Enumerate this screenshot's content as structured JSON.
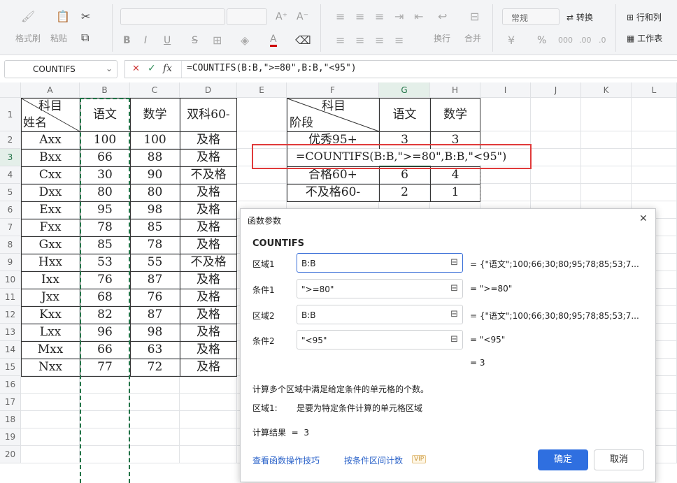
{
  "ribbon": {
    "format_painter": "格式刷",
    "paste": "粘贴",
    "wrap": "换行",
    "merge": "合并",
    "number_format": "常规",
    "convert": "转换",
    "row_col": "行和列",
    "worksheet": "工作表",
    "bold": "B",
    "italic": "I",
    "underline": "U",
    "strike": "S",
    "font_color": "A",
    "grow_font": "A⁺",
    "shrink_font": "A⁻",
    "percent": "%"
  },
  "formula_bar": {
    "name_box": "COUNTIFS",
    "cancel": "✕",
    "confirm": "✓",
    "fx": "fx",
    "formula": "=COUNTIFS(B:B,\">=80\",B:B,\"<95\")"
  },
  "sheet": {
    "columns": [
      "A",
      "B",
      "C",
      "D",
      "E",
      "F",
      "G",
      "H",
      "I",
      "J",
      "K",
      "L"
    ],
    "rows": [
      "1",
      "2",
      "3",
      "4",
      "5",
      "6",
      "7",
      "8",
      "9",
      "10",
      "11",
      "12",
      "13",
      "14",
      "15",
      "16",
      "17",
      "18",
      "19",
      "20"
    ],
    "a1_top": "科目",
    "a1_bottom": "姓名",
    "header_b": "语文",
    "header_c": "数学",
    "header_d": "双科60-",
    "data": [
      [
        "Axx",
        "100",
        "100",
        "及格"
      ],
      [
        "Bxx",
        "66",
        "88",
        "及格"
      ],
      [
        "Cxx",
        "30",
        "90",
        "不及格"
      ],
      [
        "Dxx",
        "80",
        "80",
        "及格"
      ],
      [
        "Exx",
        "95",
        "98",
        "及格"
      ],
      [
        "Fxx",
        "78",
        "85",
        "及格"
      ],
      [
        "Gxx",
        "85",
        "78",
        "及格"
      ],
      [
        "Hxx",
        "53",
        "55",
        "不及格"
      ],
      [
        "Ixx",
        "76",
        "87",
        "及格"
      ],
      [
        "Jxx",
        "68",
        "76",
        "及格"
      ],
      [
        "Kxx",
        "82",
        "87",
        "及格"
      ],
      [
        "Lxx",
        "96",
        "98",
        "及格"
      ],
      [
        "Mxx",
        "66",
        "63",
        "及格"
      ],
      [
        "Nxx",
        "77",
        "72",
        "及格"
      ]
    ],
    "f1_top": "科目",
    "f1_bottom": "阶段",
    "header_g": "语文",
    "header_h": "数学",
    "summary": [
      [
        "优秀95+",
        "3",
        "3"
      ],
      [
        "",
        "",
        ""
      ],
      [
        "合格60+",
        "6",
        "4"
      ],
      [
        "不及格60-",
        "2",
        "1"
      ]
    ],
    "editing_formula": "=COUNTIFS(B:B,\">=80\",B:B,\"<95\")"
  },
  "dialog": {
    "title": "函数参数",
    "close": "✕",
    "function_name": "COUNTIFS",
    "args": [
      {
        "label": "区域1",
        "value": "B:B",
        "result": "= {\"语文\";100;66;30;80;95;78;85;53;7..."
      },
      {
        "label": "条件1",
        "value": "\">=80\"",
        "result": "= \">=80\""
      },
      {
        "label": "区域2",
        "value": "B:B",
        "result": "= {\"语文\";100;66;30;80;95;78;85;53;7..."
      },
      {
        "label": "条件2",
        "value": "\"<95\"",
        "result": "= \"<95\""
      }
    ],
    "total": "= 3",
    "description": "计算多个区域中满足给定条件的单元格的个数。",
    "arg_help_label": "区域1:",
    "arg_help_text": "是要为特定条件计算的单元格区域",
    "calc_result_label": "计算结果  =  3",
    "link_tips": "查看函数操作技巧",
    "link_range": "按条件区间计数",
    "vip": "VIP",
    "ok": "确定",
    "cancel": "取消"
  },
  "colors": {
    "accent": "#217346",
    "primary_button": "#2f6fe0",
    "highlight_box": "#e03a3a",
    "link": "#2a62c9"
  }
}
